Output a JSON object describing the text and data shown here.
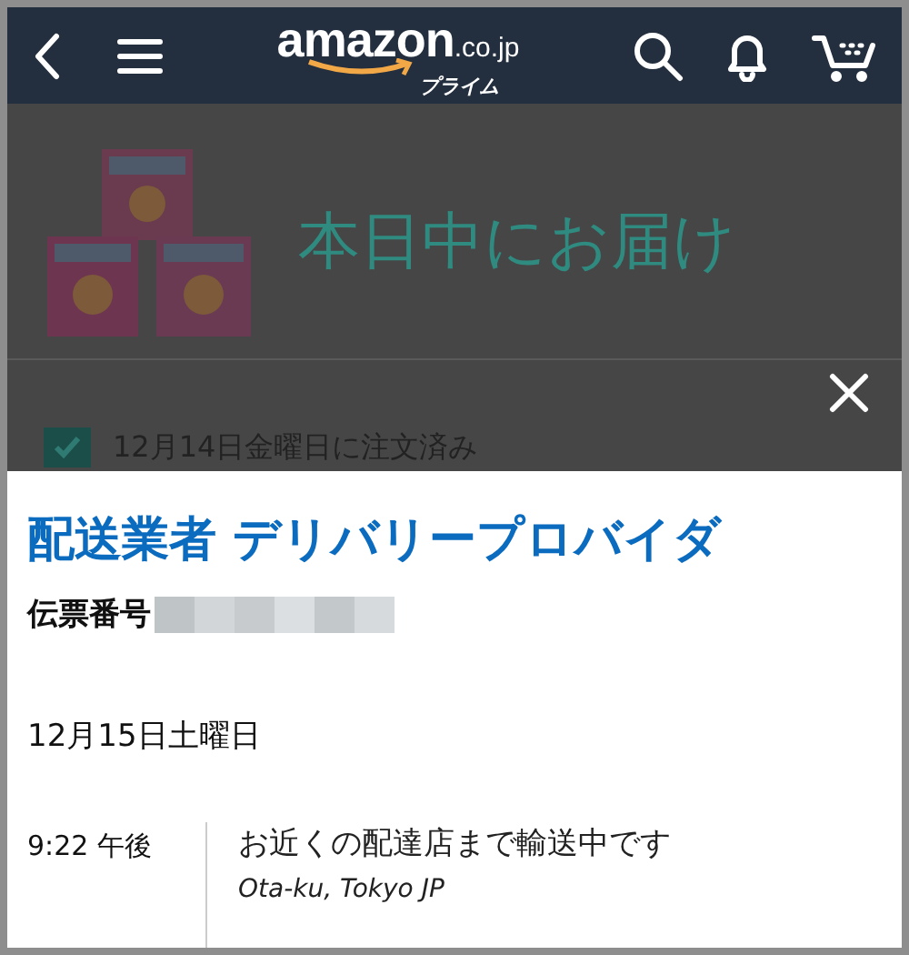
{
  "header": {
    "logo": "amazon",
    "logo_domain": ".co.jp",
    "logo_sub": "プライム"
  },
  "background": {
    "delivery_heading": "本日中にお届け",
    "status": {
      "label": "12月14日金曜日に注文済み",
      "checked": true
    }
  },
  "sheet": {
    "title": "配送業者 デリバリープロバイダ",
    "tracking_label": "伝票番号",
    "date": "12月15日土曜日",
    "events": [
      {
        "time": "9:22 午後",
        "description": "お近くの配達店まで輸送中です",
        "location": "Ota-ku, Tokyo JP"
      }
    ]
  }
}
